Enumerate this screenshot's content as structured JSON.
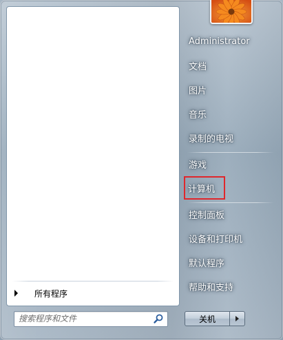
{
  "start_menu": {
    "all_programs_label": "所有程序",
    "search": {
      "placeholder": "搜索程序和文件",
      "value": ""
    },
    "icons": {
      "search": "search-icon",
      "user_picture": "flower-picture",
      "all_programs": "triangle-right-icon",
      "shutdown_options": "triangle-right-icon"
    },
    "right_menu": {
      "items": [
        {
          "key": "administrator",
          "label": "Administrator"
        },
        {
          "key": "documents",
          "label": "文档"
        },
        {
          "key": "pictures",
          "label": "图片"
        },
        {
          "key": "music",
          "label": "音乐"
        },
        {
          "key": "recorded_tv",
          "label": "录制的电视"
        },
        {
          "key": "games",
          "label": "游戏"
        },
        {
          "key": "computer",
          "label": "计算机",
          "highlighted": true
        },
        {
          "key": "control_panel",
          "label": "控制面板"
        },
        {
          "key": "devices_printers",
          "label": "设备和打印机"
        },
        {
          "key": "default_programs",
          "label": "默认程序"
        },
        {
          "key": "help_support",
          "label": "帮助和支持"
        }
      ]
    },
    "shutdown_label": "关机",
    "colors": {
      "highlight_border": "#e0262b",
      "menu_text": "#ffffff"
    }
  }
}
